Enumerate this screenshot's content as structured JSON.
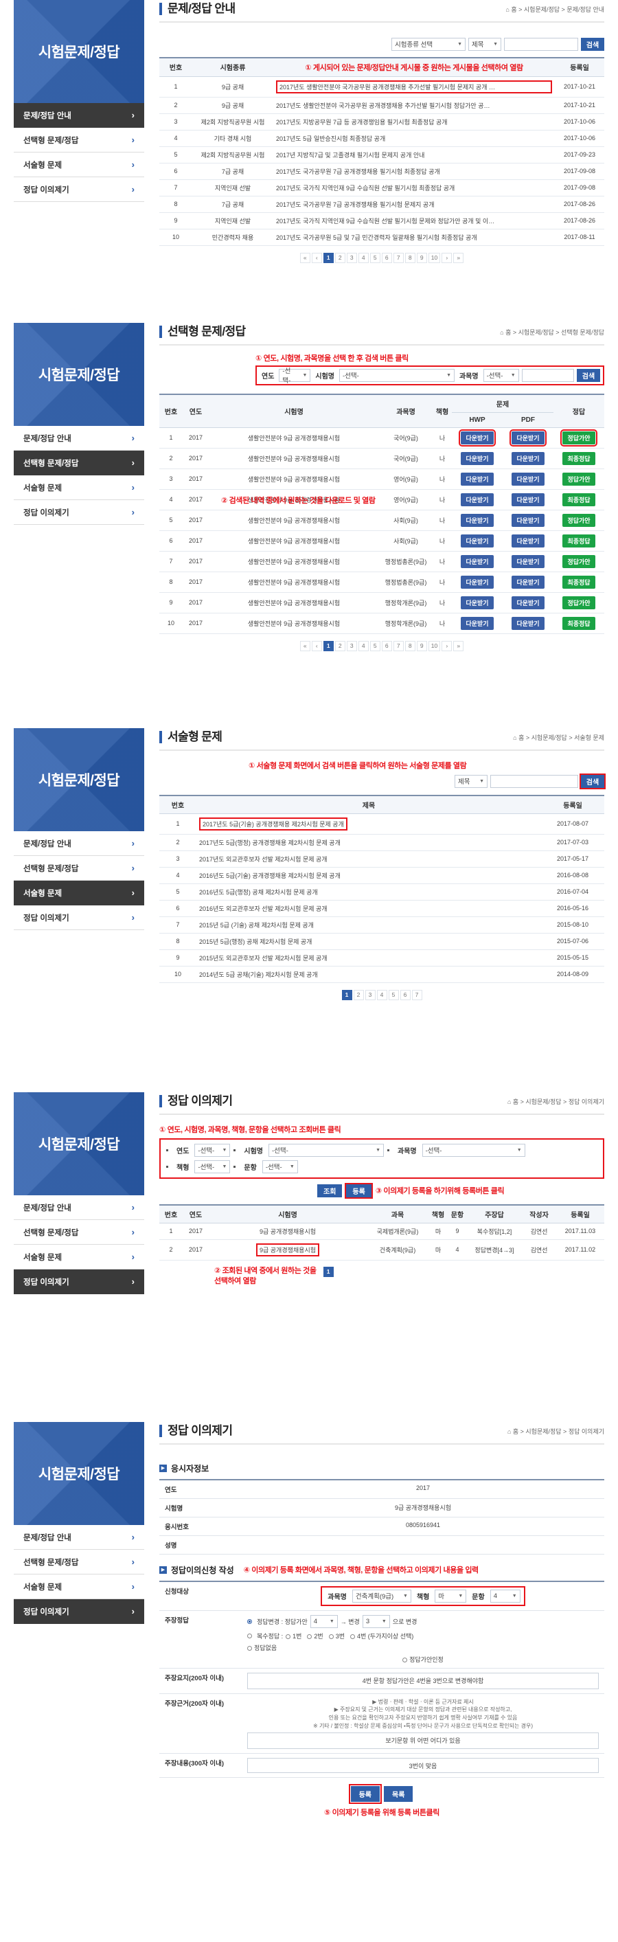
{
  "brand": {
    "title": "시험문제/정답"
  },
  "sidebar": {
    "items": [
      {
        "label": "문제/정답 안내",
        "icon": "chevron-right-icon"
      },
      {
        "label": "선택형 문제/정답",
        "icon": "chevron-right-icon"
      },
      {
        "label": "서술형 문제",
        "icon": "chevron-right-icon"
      },
      {
        "label": "정답 이의제기",
        "icon": "chevron-right-icon"
      }
    ]
  },
  "common": {
    "home_icon": "home-icon",
    "search_button": "검색",
    "select_placeholder": "-선택-",
    "caret": "▼",
    "pager": {
      "first": "«",
      "prev": "‹",
      "next": "›",
      "last": "»"
    }
  },
  "section1": {
    "title": "문제/정답 안내",
    "breadcrumb": "홈 > 시험문제/정답 > 문제/정답 안내",
    "search": {
      "type_select": "시험종류 선택",
      "field_select": "제목",
      "keyword": "",
      "button": "검색"
    },
    "annotation": "① 게시되어 있는 문제/정답안내 게시물 중 원하는 게시물을 선택하여 열람",
    "columns": [
      "번호",
      "시험종류",
      "제목",
      "등록일"
    ],
    "rows": [
      {
        "no": "1",
        "type": "9급 공채",
        "title": "2017년도 생활안전분야 국가공무원 공개경쟁채용 추가선발 필기시험 문제지 공개 …",
        "date": "2017-10-21",
        "highlight": true
      },
      {
        "no": "2",
        "type": "9급 공채",
        "title": "2017년도 생활안전분야 국가공무원 공개경쟁채용 추가선발 필기시험 정답가안 공…",
        "date": "2017-10-21",
        "highlight": false
      },
      {
        "no": "3",
        "type": "제2회 지방직공무원 시험",
        "title": "2017년도 지방공무원 7급 등 공개경쟁임용 필기시험 최종정답 공개",
        "date": "2017-10-06",
        "highlight": false
      },
      {
        "no": "4",
        "type": "기타 경채 시험",
        "title": "2017년도 5급 일반승진시험 최종정답 공개",
        "date": "2017-10-06",
        "highlight": false
      },
      {
        "no": "5",
        "type": "제2회 지방직공무원 시험",
        "title": "2017년 지방직7급 및 고졸경채 필기시험 문제지 공개 안내",
        "date": "2017-09-23",
        "highlight": false
      },
      {
        "no": "6",
        "type": "7급 공채",
        "title": "2017년도 국가공무원 7급 공개경쟁채용 필기시험 최종정답 공개",
        "date": "2017-09-08",
        "highlight": false
      },
      {
        "no": "7",
        "type": "지역인재 선발",
        "title": "2017년도 국가직 지역인재 9급 수습직원 선발 필기시험 최종정답 공개",
        "date": "2017-09-08",
        "highlight": false
      },
      {
        "no": "8",
        "type": "7급 공채",
        "title": "2017년도 국가공무원 7급 공개경쟁채용 필기시험 문제지 공개",
        "date": "2017-08-26",
        "highlight": false
      },
      {
        "no": "9",
        "type": "지역인재 선발",
        "title": "2017년도 국가직 지역인재 9급 수습직원 선발 필기시험 문제와 정답가안 공개 및 이…",
        "date": "2017-08-26",
        "highlight": false
      },
      {
        "no": "10",
        "type": "민간경력자 채용",
        "title": "2017년도 국가공무원 5급 및 7급 민간경력자 일괄채용 필기시험 최종정답 공개",
        "date": "2017-08-11",
        "highlight": false
      }
    ],
    "pages": [
      "1",
      "2",
      "3",
      "4",
      "5",
      "6",
      "7",
      "8",
      "9",
      "10"
    ],
    "current_page": "1"
  },
  "section2": {
    "title": "선택형 문제/정답",
    "breadcrumb": "홈 > 시험문제/정답 > 선택형 문제/정답",
    "annotation1": "① 연도, 시험명, 과목명을 선택 한 후 검색 버튼 클릭",
    "annotation2": "② 검색된 내역 중에서 원하는 것을 다운로드 및 열람",
    "filters": [
      {
        "label": "연도",
        "value": "-선택-",
        "width": 46
      },
      {
        "label": "시험명",
        "value": "-선택-",
        "width": 168
      },
      {
        "label": "과목명",
        "value": "-선택-",
        "width": 52
      }
    ],
    "keyword": "",
    "search_button": "검색",
    "columns": {
      "no": "번호",
      "year": "연도",
      "exam": "시험명",
      "subject": "과목명",
      "form": "책형",
      "problem": "문제",
      "hwp": "HWP",
      "pdf": "PDF",
      "answer": "정답"
    },
    "download_label": "다운받기",
    "rows": [
      {
        "no": "1",
        "year": "2017",
        "exam": "생활안전분야 9급 공개경쟁채용시험",
        "subject": "국어(9급)",
        "form": "나",
        "answer": "정답가안",
        "highlight": true
      },
      {
        "no": "2",
        "year": "2017",
        "exam": "생활안전분야 9급 공개경쟁채용시험",
        "subject": "국어(9급)",
        "form": "나",
        "answer": "최종정답",
        "highlight": false
      },
      {
        "no": "3",
        "year": "2017",
        "exam": "생활안전분야 9급 공개경쟁채용시험",
        "subject": "영어(9급)",
        "form": "나",
        "answer": "정답가안",
        "highlight": false
      },
      {
        "no": "4",
        "year": "2017",
        "exam": "생활안전분야 9급 공개경쟁채용시험",
        "subject": "영어(9급)",
        "form": "나",
        "answer": "최종정답",
        "highlight": false
      },
      {
        "no": "5",
        "year": "2017",
        "exam": "생활안전분야 9급 공개경쟁채용시험",
        "subject": "사회(9급)",
        "form": "나",
        "answer": "정답가안",
        "highlight": false
      },
      {
        "no": "6",
        "year": "2017",
        "exam": "생활안전분야 9급 공개경쟁채용시험",
        "subject": "사회(9급)",
        "form": "나",
        "answer": "최종정답",
        "highlight": false
      },
      {
        "no": "7",
        "year": "2017",
        "exam": "생활안전분야 9급 공개경쟁채용시험",
        "subject": "행정법총론(9급)",
        "form": "나",
        "answer": "정답가안",
        "highlight": false
      },
      {
        "no": "8",
        "year": "2017",
        "exam": "생활안전분야 9급 공개경쟁채용시험",
        "subject": "행정법총론(9급)",
        "form": "나",
        "answer": "최종정답",
        "highlight": false
      },
      {
        "no": "9",
        "year": "2017",
        "exam": "생활안전분야 9급 공개경쟁채용시험",
        "subject": "행정학개론(9급)",
        "form": "나",
        "answer": "정답가안",
        "highlight": false
      },
      {
        "no": "10",
        "year": "2017",
        "exam": "생활안전분야 9급 공개경쟁채용시험",
        "subject": "행정학개론(9급)",
        "form": "나",
        "answer": "최종정답",
        "highlight": false
      }
    ],
    "pages": [
      "1",
      "2",
      "3",
      "4",
      "5",
      "6",
      "7",
      "8",
      "9",
      "10"
    ],
    "current_page": "1"
  },
  "section3": {
    "title": "서술형 문제",
    "breadcrumb": "홈 > 시험문제/정답 > 서술형 문제",
    "annotation": "① 서술형 문제 화면에서 검색 버튼을 클릭하여 원하는 서술형 문제를 열람",
    "search": {
      "field_select": "제목",
      "keyword": "",
      "button": "검색"
    },
    "columns": [
      "번호",
      "제목",
      "등록일"
    ],
    "rows": [
      {
        "no": "1",
        "title": "2017년도 5급(기술) 공개경쟁채용 제2차시험 문제 공개",
        "date": "2017-08-07",
        "highlight": true
      },
      {
        "no": "2",
        "title": "2017년도 5급(행정) 공개경쟁채용 제2차시험 문제 공개",
        "date": "2017-07-03",
        "highlight": false
      },
      {
        "no": "3",
        "title": "2017년도 외교관후보자 선발 제2차시험 문제 공개",
        "date": "2017-05-17",
        "highlight": false
      },
      {
        "no": "4",
        "title": "2016년도 5급(기술) 공개경쟁채용 제2차시험 문제 공개",
        "date": "2016-08-08",
        "highlight": false
      },
      {
        "no": "5",
        "title": "2016년도 5급(행정) 공채 제2차시험 문제 공개",
        "date": "2016-07-04",
        "highlight": false
      },
      {
        "no": "6",
        "title": "2016년도 외교관후보자 선발 제2차시험 문제 공개",
        "date": "2016-05-16",
        "highlight": false
      },
      {
        "no": "7",
        "title": "2015년 5급 (기술) 공채 제2차시험 문제 공개",
        "date": "2015-08-10",
        "highlight": false
      },
      {
        "no": "8",
        "title": "2015년 5급(행정) 공채 제2차시험 문제 공개",
        "date": "2015-07-06",
        "highlight": false
      },
      {
        "no": "9",
        "title": "2015년도 외교관후보자 선발 제2차시험 문제 공개",
        "date": "2015-05-15",
        "highlight": false
      },
      {
        "no": "10",
        "title": "2014년도 5급 공채(기술) 제2차시험 문제 공개",
        "date": "2014-08-09",
        "highlight": false
      }
    ],
    "pages": [
      "1",
      "2",
      "3",
      "4",
      "5",
      "6",
      "7"
    ],
    "current_page": "1"
  },
  "section4": {
    "title": "정답 이의제기",
    "breadcrumb": "홈 > 시험문제/정답 > 정답 이의제기",
    "annotation1": "① 연도, 시험명, 과목명, 책형, 문항을 선택하고 조회버튼 클릭",
    "annotation2": "② 조회된 내역 중에서 원하는 것을\n선택하여 열람",
    "annotation3": "③ 이의제기 등록을 하기위해 등록버튼 클릭",
    "filters_row1": [
      {
        "label": "연도",
        "value": "-선택-",
        "width": 52
      },
      {
        "label": "시험명",
        "value": "-선택-",
        "width": 168
      },
      {
        "label": "과목명",
        "value": "-선택-",
        "width": 150
      }
    ],
    "filters_row2": [
      {
        "label": "책형",
        "value": "-선택-",
        "width": 52
      },
      {
        "label": "문항",
        "value": "-선택-",
        "width": 52
      }
    ],
    "buttons": {
      "inquiry": "조회",
      "register": "등록"
    },
    "columns": [
      "번호",
      "연도",
      "시험명",
      "과목",
      "책형",
      "문항",
      "주장답",
      "작성자",
      "등록일"
    ],
    "rows": [
      {
        "no": "1",
        "year": "2017",
        "exam": "9급 공개경쟁채용시험",
        "subject": "국제법개론(9급)",
        "form": "마",
        "item": "9",
        "claim": "복수정답[1,2]",
        "writer": "김연선",
        "date": "2017.11.03",
        "highlight": false
      },
      {
        "no": "2",
        "year": "2017",
        "exam": "9급 공개경쟁채용시험",
        "subject": "건축계획(9급)",
        "form": "마",
        "item": "4",
        "claim": "정답변경[4→3]",
        "writer": "김연선",
        "date": "2017.11.02",
        "highlight": true
      }
    ],
    "current_page": "1"
  },
  "section5": {
    "title": "정답 이의제기",
    "breadcrumb": "홈 > 시험문제/정답 > 정답 이의제기",
    "annotation4": "④ 이의제기 등록 화면에서 과목명, 책형, 문항을 선택하고 이의제기 내용을 입력",
    "annotation5": "⑤ 이의제기 등록을 위해 등록 버튼클릭",
    "applicant_section": "응시자정보",
    "applicant_fields": [
      {
        "label": "연도",
        "value": "2017"
      },
      {
        "label": "시험명",
        "value": "9급 공개경쟁채용시험"
      },
      {
        "label": "응시번호",
        "value": "0805916941"
      },
      {
        "label": "성명",
        "value": ""
      }
    ],
    "claim_section": "정답이의신청 작성",
    "target_label": "신청대상",
    "target_fields": [
      {
        "label": "과목명",
        "value": "건축계획(9급)",
        "width": 86
      },
      {
        "label": "책형",
        "value": "마",
        "width": 46
      },
      {
        "label": "문항",
        "value": "4",
        "width": 44
      }
    ],
    "claim_label": "주장정답",
    "claim_options_line1": [
      {
        "text": "정답변경 : 정답가안 ",
        "sel1": "4",
        "mid": " → 변경 ",
        "sel2": "3",
        "tail": " 으로 변경"
      }
    ],
    "claim_options_line2_prefix": "복수정답 : ",
    "claim_options_line2": [
      "1번",
      "2번",
      "3번",
      "4번 (두가지이상 선택)"
    ],
    "claim_options_rest": [
      "정답없음",
      "정답가안인정"
    ],
    "reason_label": "주장요지(200자 이내)",
    "reason_value": "4번 문항 정답가안은 4번을 3번으로 변경해야함",
    "detail_label": "주장근거(200자 이내)",
    "detail_guide": "▶ 법령ㆍ판례ㆍ학설ㆍ이론 등 근거자료 제시\n▶ 주장요지 및 근거는 이의제기 대상 문항의 정답과 관련된 내용으로 작성하고,\n   인용 또는 요건을 확인하고자 주장요지 반영하기 쉽게 명확 사실여부 기재를 수 있음\n   ※ 기타 / 불인정 : 학설상 문제 중심상의 ・특정 단어나 문구가 사용으로 단독적으로 확인되는 경우)",
    "detail_value": "보기문항 위 어떤 어디가 있음",
    "extra_label": "주장내용(300자 이내)",
    "extra_value": "3번이 맞음",
    "buttons": {
      "register": "등록",
      "cancel": "목록"
    }
  }
}
